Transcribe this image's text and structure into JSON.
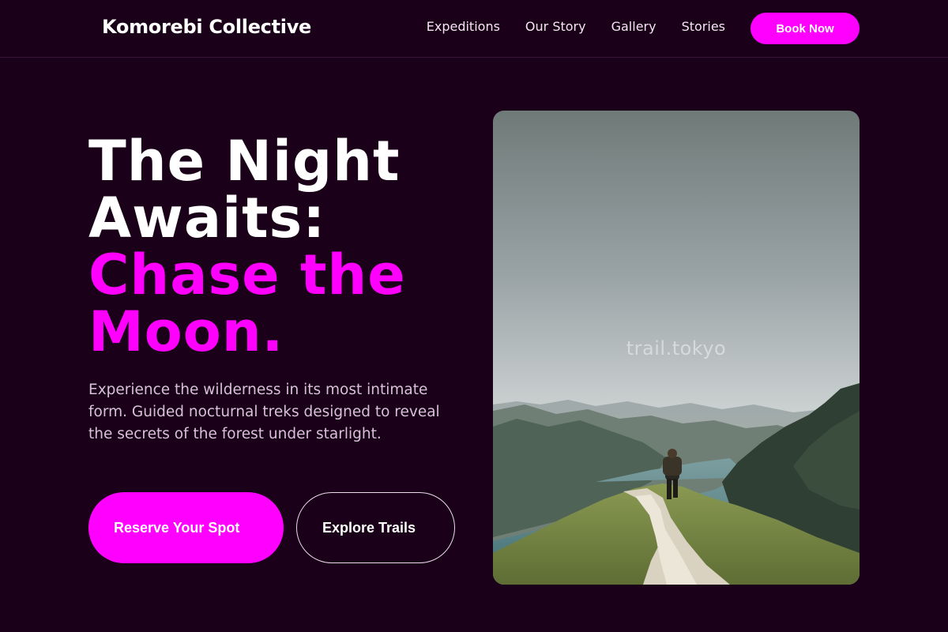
{
  "header": {
    "brand": "Komorebi Collective",
    "nav": [
      "Expeditions",
      "Our Story",
      "Gallery",
      "Stories"
    ],
    "cta": "Book Now"
  },
  "hero": {
    "headline_white_1": "The Night",
    "headline_white_2": "Awaits:",
    "headline_accent_1": "Chase the",
    "headline_accent_2": "Moon.",
    "description": "Experience the wilderness in its most intimate form. Guided nocturnal treks designed to reveal the secrets of the forest under starlight.",
    "primary_button": "Reserve Your Spot",
    "secondary_button": "Explore Trails",
    "image_watermark": "trail.tokyo"
  },
  "colors": {
    "background": "#1a0018",
    "accent": "#ff00ff"
  },
  "icons": {
    "hero_image": "mountain-trail-hiker-photo"
  }
}
